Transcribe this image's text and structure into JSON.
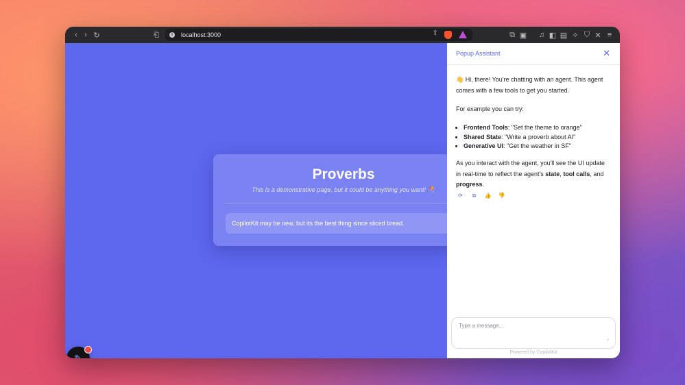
{
  "browser": {
    "url": "localhost:3000"
  },
  "page": {
    "title": "Proverbs",
    "subtitle": "This is a demonstrative page, but it could be anything you want! 🪁",
    "proverb": "CopilotKit may be new, but its the best thing since sliced bread."
  },
  "assistant": {
    "title": "Popup Assistant",
    "greeting_emoji": "👋",
    "greeting": "Hi, there! You're chatting with an agent. This agent comes with a few tools to get you started.",
    "example_intro": "For example you can try:",
    "examples": [
      {
        "label": "Frontend Tools",
        "text": ": \"Set the theme to orange\""
      },
      {
        "label": "Shared State",
        "text": ": \"Write a proverb about AI\""
      },
      {
        "label": "Generative UI",
        "text": ": \"Get the weather in SF\""
      }
    ],
    "outro_1": "As you interact with the agent, you'll see the UI update in real-time to reflect the agent's ",
    "outro_state": "state",
    "outro_sep1": ", ",
    "outro_tool": "tool calls",
    "outro_sep2": ", and ",
    "outro_progress": "progress",
    "outro_end": ".",
    "input_placeholder": "Type a message...",
    "powered_by": "Powered by CopilotKit"
  }
}
